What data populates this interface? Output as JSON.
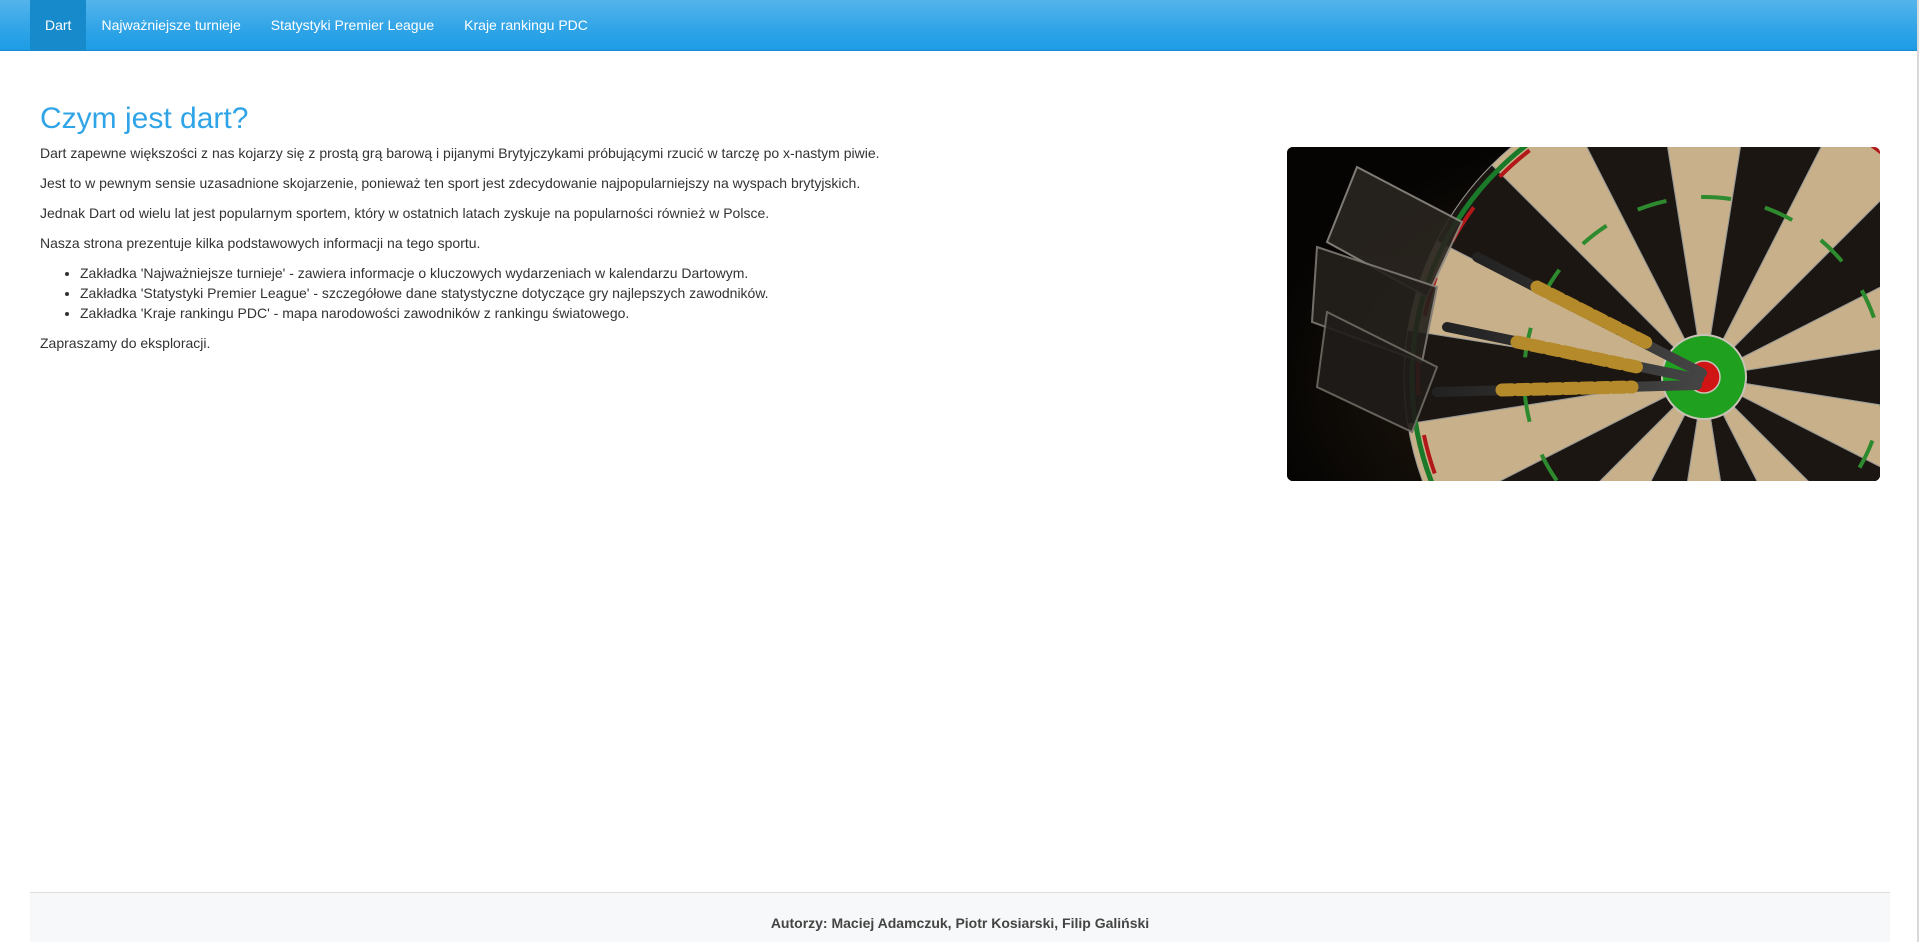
{
  "nav": {
    "items": [
      {
        "label": "Dart",
        "active": true
      },
      {
        "label": "Najważniejsze turnieje",
        "active": false
      },
      {
        "label": "Statystyki Premier League",
        "active": false
      },
      {
        "label": "Kraje rankingu PDC",
        "active": false
      }
    ]
  },
  "main": {
    "title": "Czym jest dart?",
    "paragraphs": [
      "Dart zapewne większości z nas kojarzy się z prostą grą barową i pijanymi Brytyjczykami próbującymi rzucić w tarczę po x-nastym piwie.",
      "Jest to w pewnym sensie uzasadnione skojarzenie, ponieważ ten sport jest zdecydowanie najpopularniejszy na wyspach brytyjskich.",
      "Jednak Dart od wielu lat jest popularnym sportem, który w ostatnich latach zyskuje na popularności również w Polsce.",
      "Nasza strona prezentuje kilka podstawowych informacji na tego sportu."
    ],
    "bullets": [
      "Zakładka 'Najważniejsze turnieje' - zawiera informacje o kluczowych wydarzeniach w kalendarzu Dartowym.",
      "Zakładka 'Statystyki Premier League' - szczegółowe dane statystyczne dotyczące gry najlepszych zawodników.",
      "Zakładka 'Kraje rankingu PDC' - mapa narodowości zawodników z rankingu światowego."
    ],
    "closing": "Zapraszamy do eksploracji."
  },
  "footer": {
    "authors": "Autorzy: Maciej Adamczuk, Piotr Kosiarski, Filip Galiński"
  },
  "colors": {
    "navbar": "#2fa4e7",
    "nav_active": "#178acc",
    "title": "#2fa4e7",
    "bull_green": "#1fa01f",
    "bull_red": "#d11414"
  }
}
